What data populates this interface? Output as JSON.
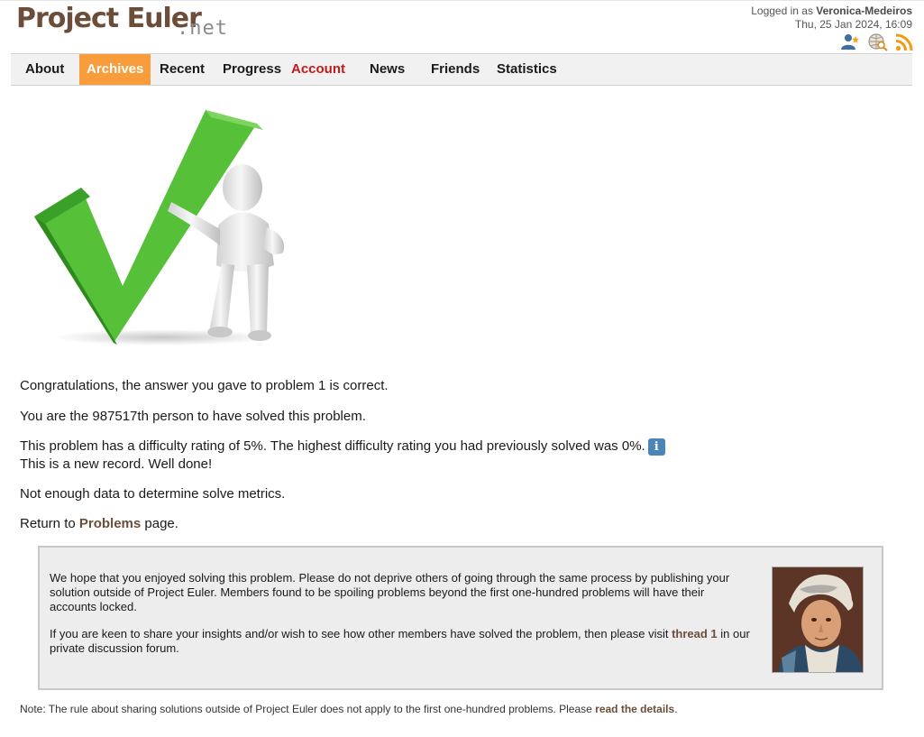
{
  "header": {
    "logo_main": "Project Euler",
    "logo_sub": ".net",
    "logged_in_prefix": "Logged in as ",
    "username": "Veronica-Medeiros",
    "datetime": "Thu, 25 Jan 2024, 16:09",
    "icons": [
      "add-friend-icon",
      "search-globe-icon",
      "rss-icon"
    ]
  },
  "nav": {
    "items": [
      "About",
      "Archives",
      "Recent",
      "Progress",
      "Account",
      "News",
      "Friends",
      "Statistics"
    ],
    "active": "Archives"
  },
  "result": {
    "line1": "Congratulations, the answer you gave to problem 1 is correct.",
    "line2": "You are the 987517th person to have solved this problem.",
    "line3": "This problem has a difficulty rating of 5%. The highest difficulty rating you had previously solved was 0%.",
    "info_label": "i",
    "line4": "This is a new record. Well done!",
    "line5": "Not enough data to determine solve metrics.",
    "return_prefix": "Return to ",
    "return_link": "Problems",
    "return_suffix": " page."
  },
  "notice": {
    "para1": "We hope that you enjoyed solving this problem. Please do not deprive others of going through the same process by publishing your solution outside of Project Euler. Members found to be spoiling problems beyond the first one-hundred problems will have their accounts locked.",
    "para2_prefix": "If you are keen to share your insights and/or wish to see how other members have solved the problem, then please visit ",
    "para2_link": "thread 1",
    "para2_suffix": " in our private discussion forum."
  },
  "footnote": {
    "prefix": "Note: The rule about sharing solutions outside of Project Euler does not apply to the first one-hundred problems. Please ",
    "link": "read the details",
    "suffix": "."
  },
  "colors": {
    "brand": "#6b4d3a",
    "nav_active": "#f89c3c",
    "account": "#c21a1a",
    "info": "#4a86b8"
  }
}
